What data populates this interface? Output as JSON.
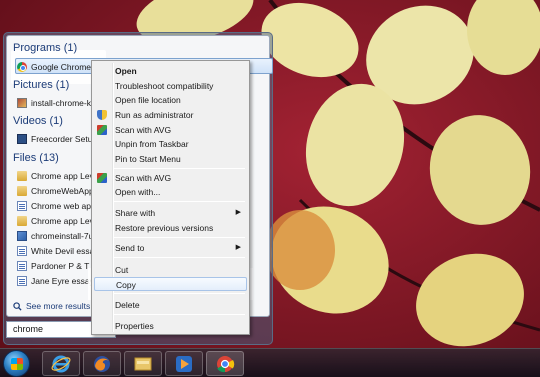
{
  "start_menu": {
    "groups": [
      {
        "title": "Programs (1)",
        "items": [
          {
            "label": "Google Chrome",
            "icon": "chrome-icon"
          }
        ]
      },
      {
        "title": "Pictures (1)",
        "items": [
          {
            "label": "install-chrome-k",
            "icon": "image-icon"
          }
        ]
      },
      {
        "title": "Videos (1)",
        "items": [
          {
            "label": "Freecorder Setup",
            "icon": "video-icon"
          }
        ]
      },
      {
        "title": "Files (13)",
        "items": [
          {
            "label": "Chrome app Lev",
            "icon": "folder-icon"
          },
          {
            "label": "ChromeWebApp",
            "icon": "folder-icon"
          },
          {
            "label": "Chrome web app",
            "icon": "document-icon"
          },
          {
            "label": "Chrome app Lev",
            "icon": "folder-icon"
          },
          {
            "label": "chromeinstall-7u",
            "icon": "installer-icon"
          },
          {
            "label": "White Devil essay",
            "icon": "document-icon"
          },
          {
            "label": "Pardoner P & T",
            "icon": "document-icon"
          },
          {
            "label": "Jane Eyre essay p",
            "icon": "document-icon"
          }
        ]
      }
    ],
    "see_more": "See more results",
    "search_value": "chrome"
  },
  "context_menu": {
    "items": [
      {
        "label": "Open",
        "bold": true
      },
      {
        "label": "Troubleshoot compatibility"
      },
      {
        "label": "Open file location"
      },
      {
        "label": "Run as administrator",
        "icon": "shield-icon"
      },
      {
        "label": "Scan with AVG",
        "icon": "avg-icon"
      },
      {
        "label": "Unpin from Taskbar"
      },
      {
        "label": "Pin to Start Menu"
      },
      {
        "label": "Scan with AVG",
        "icon": "avg-icon"
      },
      {
        "label": "Open with..."
      },
      {
        "label": "Share with",
        "submenu": true
      },
      {
        "label": "Restore previous versions"
      },
      {
        "label": "Send to",
        "submenu": true
      },
      {
        "label": "Cut"
      },
      {
        "label": "Copy"
      },
      {
        "label": "Delete"
      },
      {
        "label": "Properties"
      }
    ]
  },
  "taskbar": {
    "items": [
      "start-orb",
      "internet-explorer-icon",
      "firefox-icon",
      "file-explorer-icon",
      "media-player-icon",
      "chrome-icon"
    ]
  },
  "colors": {
    "wallpaper": "#7a1420",
    "leaf": "#e8df9a",
    "group_title": "#1c3c78",
    "menu_bg": "#f0f0f0"
  }
}
